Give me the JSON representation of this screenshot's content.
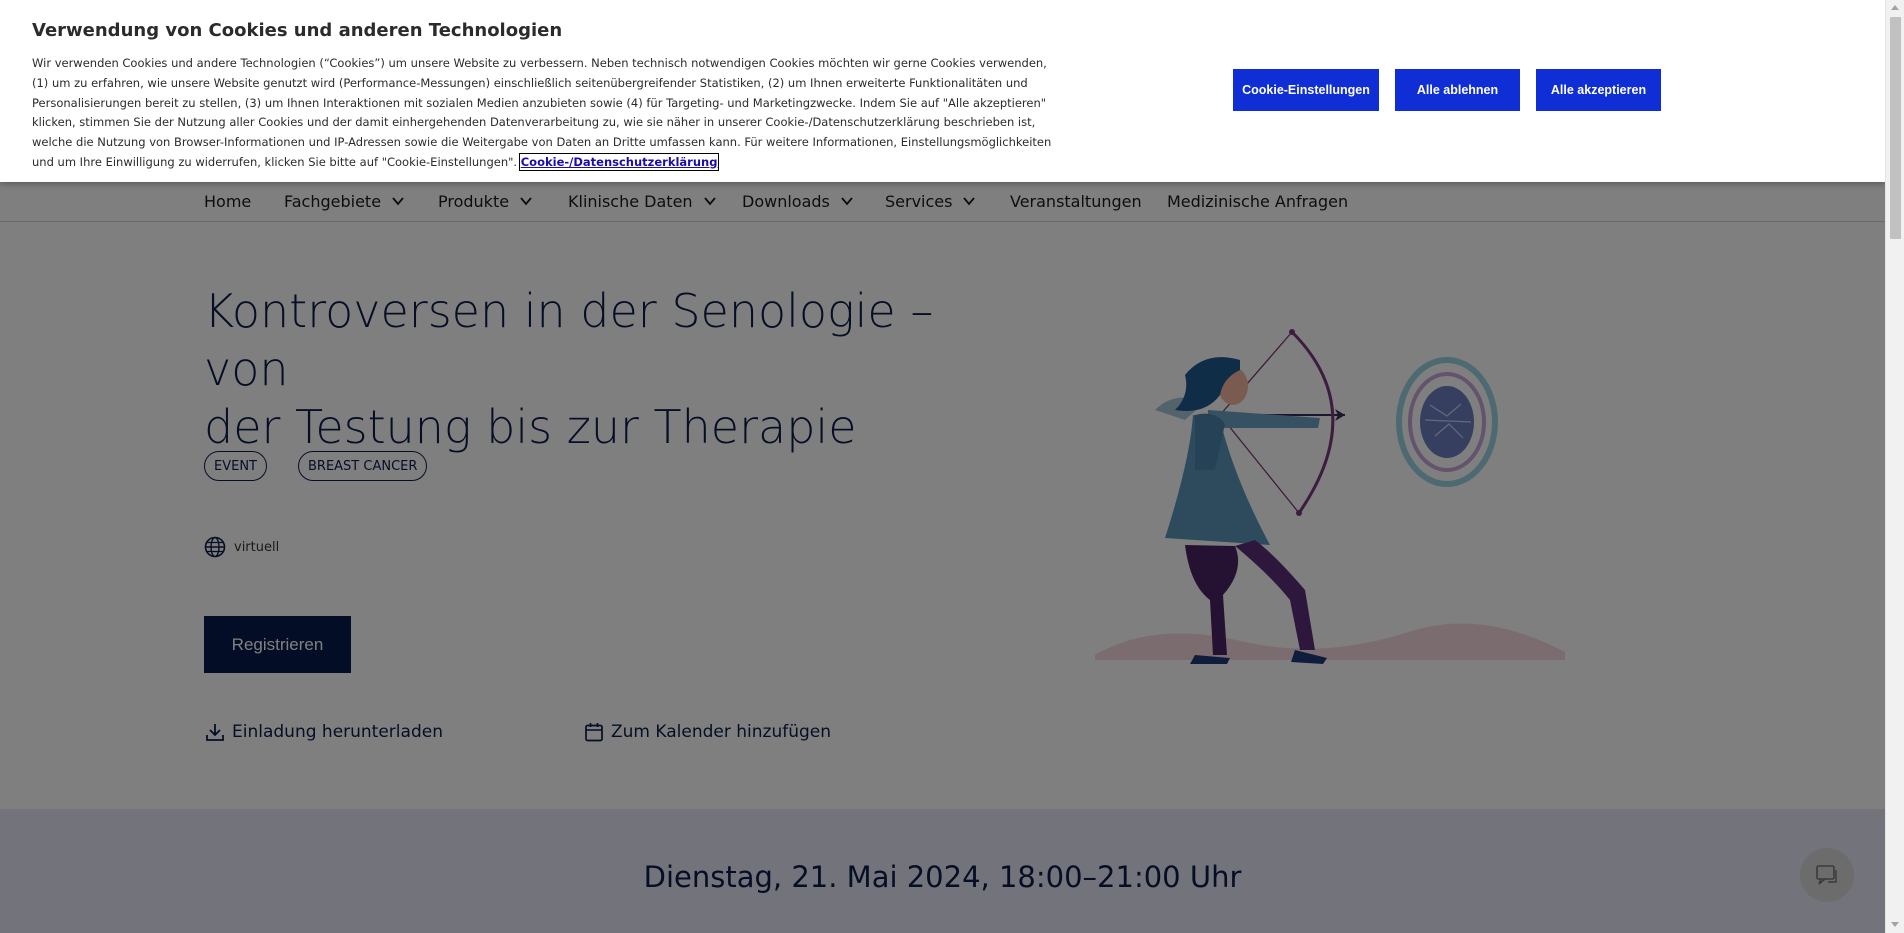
{
  "cookie_banner": {
    "title": "Verwendung von Cookies und anderen Technologien",
    "text": "Wir verwenden Cookies und andere Technologien (“Cookies”) um unsere Website zu verbessern. Neben technisch notwendigen Cookies möchten wir gerne Cookies verwenden, (1) um zu erfahren, wie unsere Website genutzt wird (Performance-Messungen) einschließlich seitenübergreifender Statistiken, (2) um Ihnen erweiterte Funktionalitäten und Personalisierungen bereit zu stellen, (3) um Ihnen Interaktionen mit sozialen Medien anzubieten sowie (4) für Targeting- und Marketingzwecke. Indem Sie auf \"Alle akzeptieren\" klicken, stimmen Sie der Nutzung aller Cookies und der damit einhergehenden Datenverarbeitung zu, wie sie näher in unserer Cookie-/Datenschutzerklärung beschrieben ist, welche die Nutzung von Browser-Informationen und IP-Adressen sowie die Weitergabe von Daten an Dritte umfassen kann. Für weitere Informationen, Einstellungsmöglichkeiten und um Ihre Einwilligung zu widerrufen, klicken Sie bitte auf \"Cookie-Einstellungen\".",
    "link_label": "Cookie-/Datenschutzerklärung",
    "settings_label": "Cookie-Einstellungen",
    "reject_label": "Alle ablehnen",
    "accept_label": "Alle akzeptieren",
    "button_color": "#0f2ed6"
  },
  "nav": {
    "items": [
      {
        "label": "Home"
      },
      {
        "label": "Fachgebiete",
        "dropdown": true
      },
      {
        "label": "Produkte",
        "dropdown": true
      },
      {
        "label": "Klinische Daten",
        "dropdown": true
      },
      {
        "label": "Downloads",
        "dropdown": true
      },
      {
        "label": "Services",
        "dropdown": true
      },
      {
        "label": "Veranstaltungen"
      },
      {
        "label": "Medizinische Anfragen"
      }
    ]
  },
  "hero": {
    "title_line1": "Kontroversen in der Senologie – von",
    "title_line2": "der Testung bis zur Therapie",
    "tags": [
      "EVENT",
      "BREAST CANCER"
    ],
    "location": "virtuell",
    "location_icon": "globe-icon",
    "register_label": "Registrieren",
    "download_label": "Einladung herunterladen",
    "download_icon": "download-icon",
    "calendar_label": "Zum Kalender hinzufügen",
    "calendar_icon": "calendar-icon"
  },
  "event_date": "Dienstag, 21. Mai 2024, 18:00–21:00 Uhr",
  "colors": {
    "navy": "#0a1d4a",
    "button_navy": "#061a4c",
    "date_band": "#e7e9f6"
  }
}
